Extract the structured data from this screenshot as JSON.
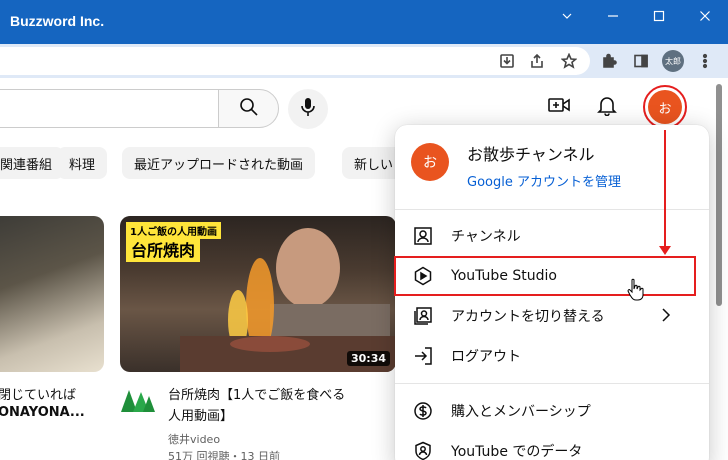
{
  "window": {
    "title": "Buzzword Inc.",
    "titlebar_color": "#1565c0"
  },
  "browser": {
    "profile_label": "太郎",
    "toolbar_icons": [
      "install-icon",
      "share-icon",
      "star-icon",
      "extensions-icon",
      "sidepanel-icon",
      "profile-avatar",
      "more-icon"
    ]
  },
  "youtube": {
    "header": {
      "search_icon": "search-icon",
      "mic_icon": "mic-icon",
      "create_icon": "video-plus-icon",
      "notifications_icon": "bell-icon",
      "avatar_text": "お"
    },
    "chips": [
      "関連番組",
      "料理",
      "最近アップロードされた動画",
      "新しい"
    ],
    "videos": [
      {
        "title_line1": "閉じていれば",
        "title_line2": "ONAYONA..."
      },
      {
        "overlay_small": "1人ご飯の人用動画",
        "overlay_big": "台所焼肉",
        "duration": "30:34",
        "title_line1": "台所焼肉【1人でご飯を食べる",
        "title_line2": "人用動画】",
        "channel": "徳井video",
        "stats": "51万 回視聴・13 日前"
      }
    ]
  },
  "account_menu": {
    "avatar_text": "お",
    "channel_name": "お散歩チャンネル",
    "manage_link": "Google アカウントを管理",
    "items": [
      {
        "label": "チャンネル",
        "icon": "person-box-icon"
      },
      {
        "label": "YouTube Studio",
        "icon": "studio-icon"
      },
      {
        "label": "アカウントを切り替える",
        "icon": "switch-account-icon"
      },
      {
        "label": "ログアウト",
        "icon": "logout-icon"
      },
      {
        "label": "購入とメンバーシップ",
        "icon": "dollar-icon"
      },
      {
        "label": "YouTube でのデータ",
        "icon": "shield-person-icon"
      }
    ]
  },
  "annotation_color": "#e51e1e"
}
